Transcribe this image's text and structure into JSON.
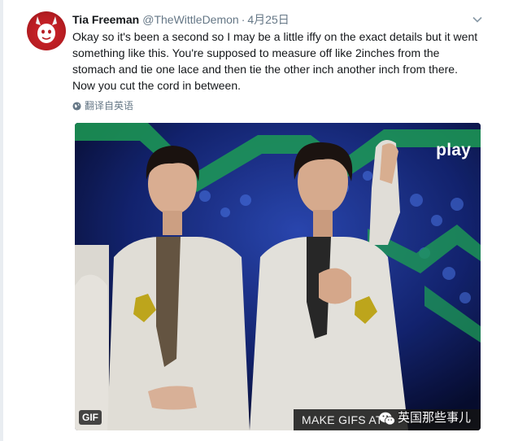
{
  "tweet": {
    "display_name": "Tia Freeman",
    "handle": "@TheWittleDemon",
    "separator": "·",
    "timestamp": "4月25日",
    "text_lines": [
      "Okay so it's been a second so I may be a little iffy on the exact details but it went",
      "something like this. You're supposed to measure off like 2inches from the",
      "stomach and tie one lace and then tie the other inch another inch from there.",
      "Now you cut the cord in between."
    ],
    "translate_label": "翻译自英语"
  },
  "media": {
    "gif_badge": "GIF",
    "overlay_caption": "MAKE GIFS AT",
    "channel_logo": "play",
    "watermark": "英国那些事儿"
  },
  "colors": {
    "name": "#14171a",
    "secondary": "#657786",
    "avatar_red": "#c8202a"
  },
  "icons": {
    "menu": "chevron-down-icon",
    "translate": "globe-icon",
    "watermark": "wechat-icon"
  }
}
